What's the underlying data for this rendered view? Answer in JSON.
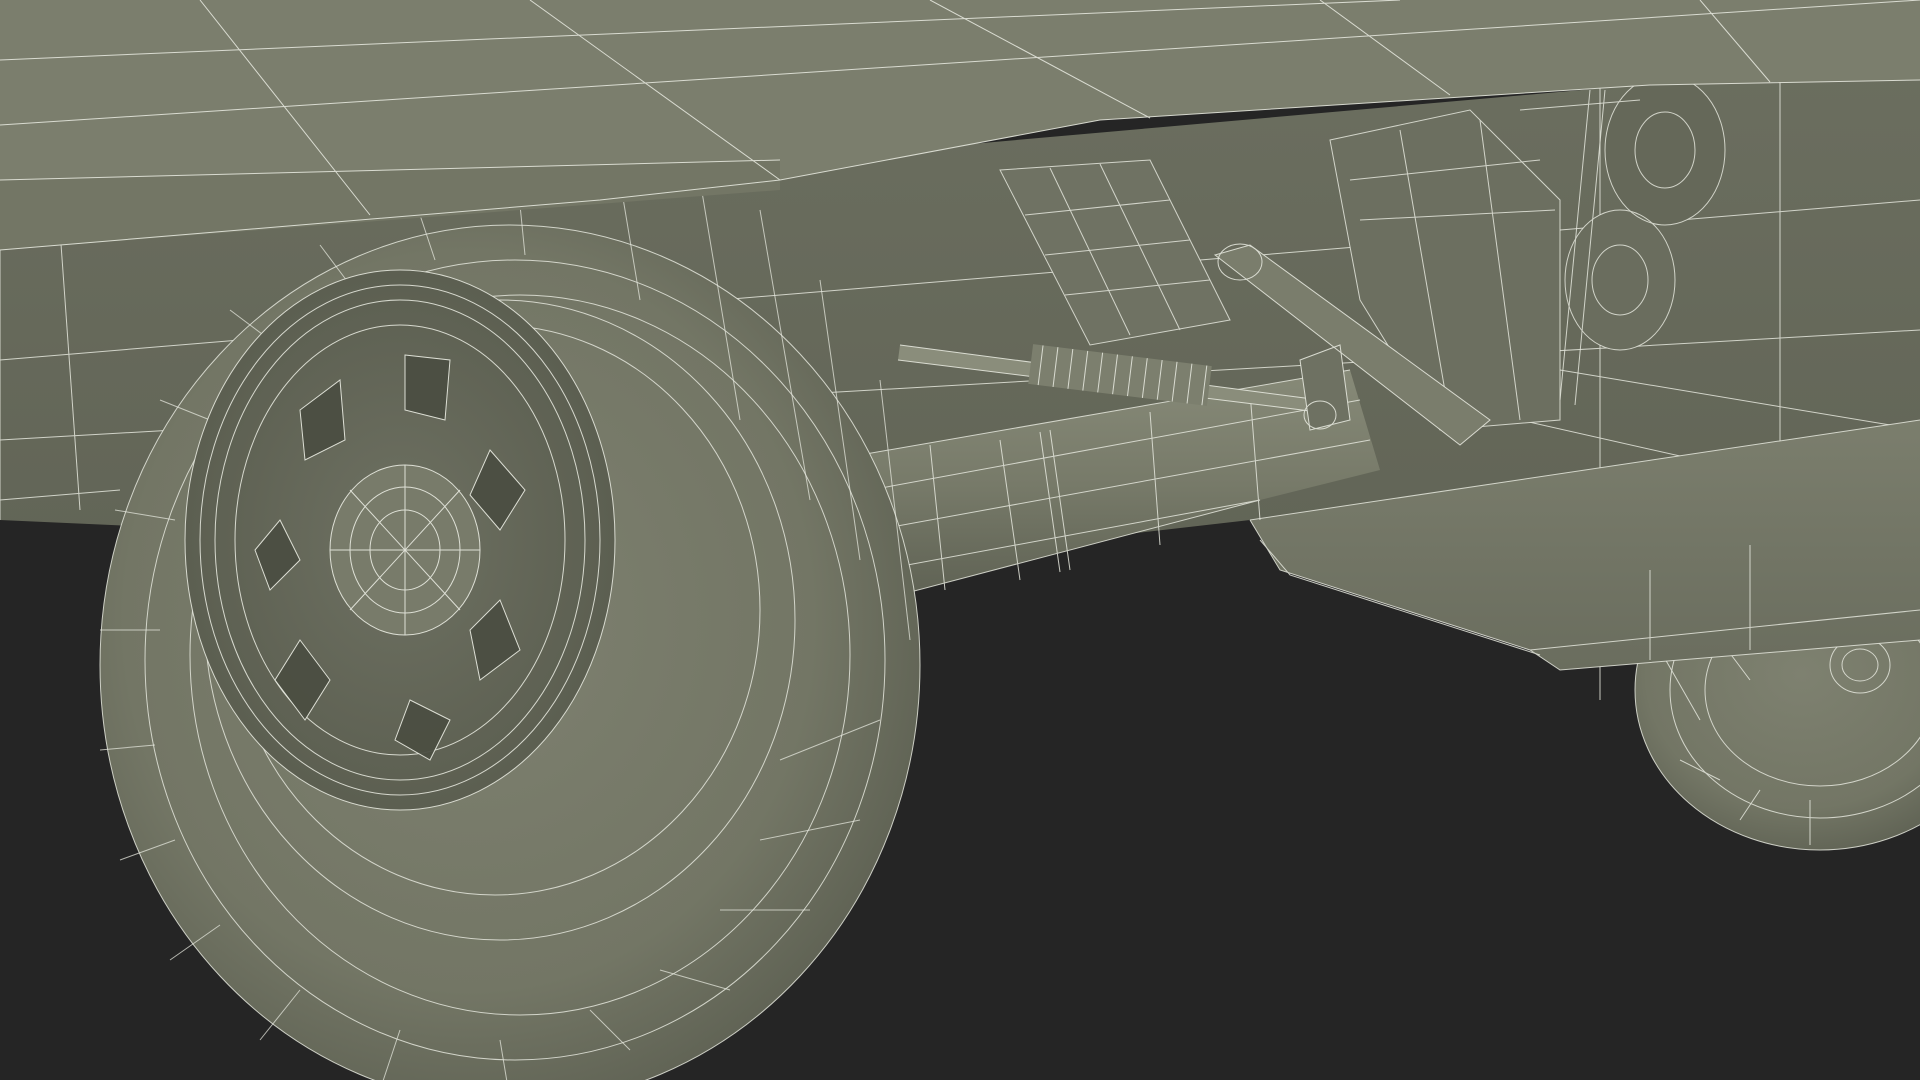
{
  "scene": {
    "subject": "wireframe-3d-model-undercarriage",
    "colors": {
      "background": "#252525",
      "surface": "#7a7d6c",
      "surface_light": "#858876",
      "surface_dark": "#5c5f50",
      "surface_shadow": "#45473c",
      "wire": "#e4e6dc"
    }
  }
}
